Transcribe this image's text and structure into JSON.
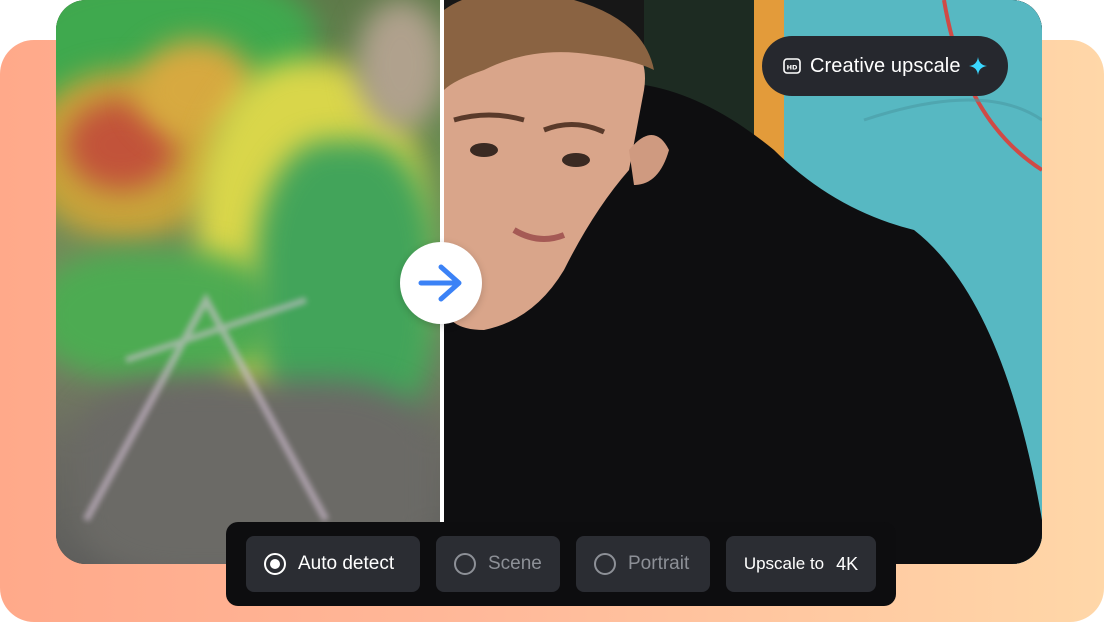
{
  "badge": {
    "label": "Creative upscale",
    "icon": "hd-icon",
    "sparkle_icon": "sparkle-icon",
    "sparkle_color": "#3ad7ff"
  },
  "center_control": {
    "icon": "arrow-right-icon",
    "accent": "#3b82f6"
  },
  "options": [
    {
      "label": "Auto detect",
      "selected": true
    },
    {
      "label": "Scene",
      "selected": false
    },
    {
      "label": "Portrait",
      "selected": false
    }
  ],
  "upscale": {
    "label": "Upscale to",
    "resolution": "4K"
  },
  "colors": {
    "backdrop_left": "#ffa98a",
    "backdrop_right": "#ffd7a8",
    "toolbar_bg": "#0d0d0f",
    "option_bg": "#2b2d33"
  }
}
